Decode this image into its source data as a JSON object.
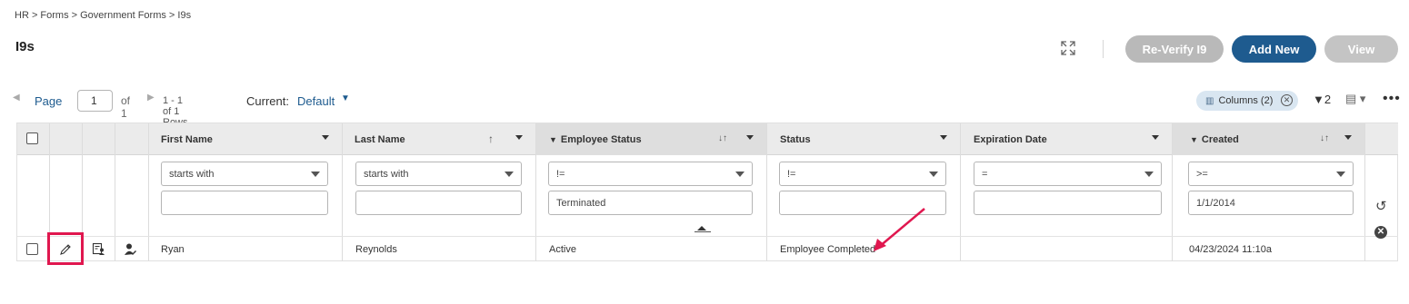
{
  "breadcrumb": "HR > Forms > Government Forms > I9s",
  "page_title": "I9s",
  "toolbar": {
    "expand_icon": "expand-arrows-icon",
    "reverify_label": "Re-Verify I9",
    "add_new_label": "Add New",
    "view_label": "View",
    "colors": {
      "primary": "#1e5b8f",
      "disabled": "#b9b9b9"
    }
  },
  "pager": {
    "page_label": "Page",
    "page_value": "1",
    "of_label": "of 1",
    "rows_label": "1 - 1 of 1 Rows",
    "current_label": "Current:",
    "current_view": "Default"
  },
  "grid_tools": {
    "columns_chip": "Columns (2)",
    "filter_count": "2"
  },
  "columns": [
    {
      "label": "First Name"
    },
    {
      "label": "Last Name"
    },
    {
      "label": "Employee Status"
    },
    {
      "label": "Status"
    },
    {
      "label": "Expiration Date"
    },
    {
      "label": "Created"
    }
  ],
  "filters": [
    {
      "operator": "starts with",
      "value": ""
    },
    {
      "operator": "starts with",
      "value": ""
    },
    {
      "operator": "!=",
      "value": "Terminated"
    },
    {
      "operator": "!=",
      "value": ""
    },
    {
      "operator": "=",
      "value": ""
    },
    {
      "operator": ">=",
      "value": "1/1/2014"
    }
  ],
  "rows": [
    {
      "first_name": "Ryan",
      "last_name": "Reynolds",
      "employee_status": "Active",
      "status": "Employee Completed",
      "expiration_date": "",
      "created": "04/23/2024 11:10a"
    }
  ],
  "annotation": {
    "highlight_color": "#e0174f"
  }
}
